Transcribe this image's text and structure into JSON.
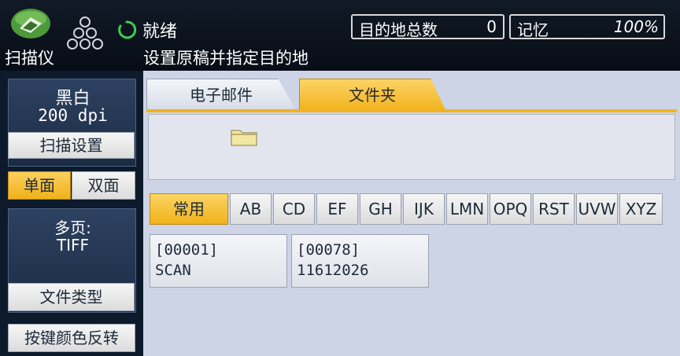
{
  "app": {
    "label": "扫描仪"
  },
  "status": {
    "text": "就绪",
    "instruction": "设置原稿并指定目的地"
  },
  "counters": {
    "dest_label": "目的地总数",
    "dest_value": "0",
    "memory_label": "记忆",
    "memory_value": "100%"
  },
  "settings": {
    "color_mode": "黑白",
    "resolution": "200 dpi",
    "scan_settings_label": "扫描设置",
    "single_sided_label": "单面",
    "double_sided_label": "双面",
    "file_pages": "多页:",
    "file_format": "TIFF",
    "file_type_label": "文件类型",
    "invert_keys_label": "按键颜色反转"
  },
  "tabs": [
    {
      "label": "电子邮件"
    },
    {
      "label": "文件夹",
      "selected": true
    }
  ],
  "index_tabs": [
    {
      "label": "常用",
      "selected": true
    },
    {
      "label": "AB"
    },
    {
      "label": "CD"
    },
    {
      "label": "EF"
    },
    {
      "label": "GH"
    },
    {
      "label": "IJK"
    },
    {
      "label": "LMN"
    },
    {
      "label": "OPQ"
    },
    {
      "label": "RST"
    },
    {
      "label": "UVW"
    },
    {
      "label": "XYZ"
    }
  ],
  "destinations": [
    {
      "id": "[00001]",
      "name": "SCAN"
    },
    {
      "id": "[00078]",
      "name": "11612026"
    }
  ],
  "colors": {
    "accent": "#f2b31f",
    "panel": "#cdd4e6",
    "dark": "#0d1a2c"
  }
}
